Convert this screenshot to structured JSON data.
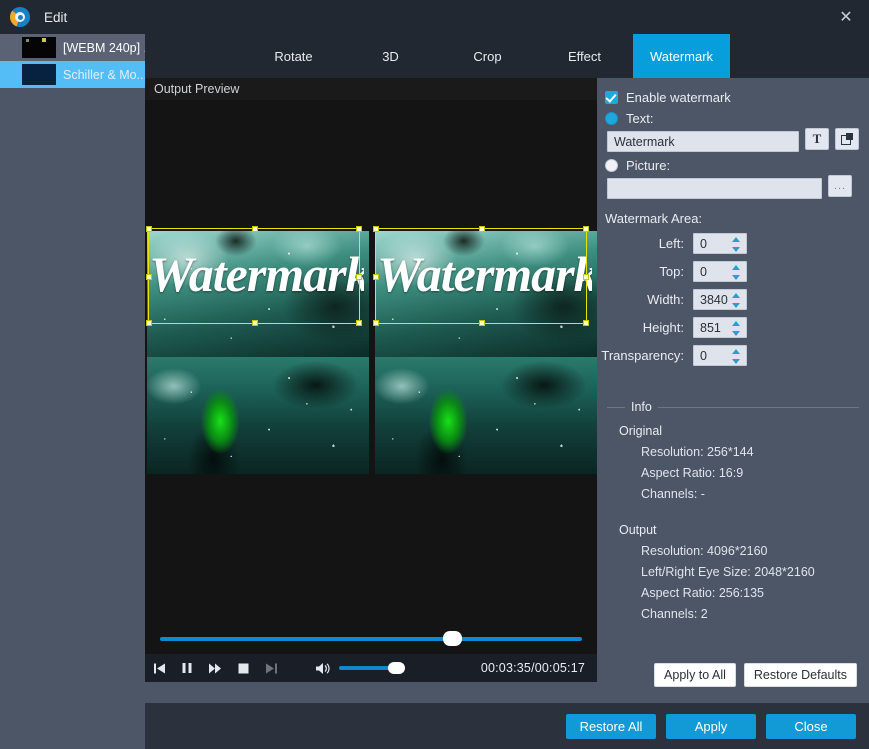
{
  "window": {
    "title": "Edit",
    "app_icon": "app-logo-icon",
    "close_icon": "close-icon"
  },
  "sidebar": {
    "items": [
      {
        "label": "[WEBM 240p] ..",
        "selected": false
      },
      {
        "label": "Schiller & Mo...",
        "selected": true
      }
    ]
  },
  "tabs": [
    {
      "label": "Rotate",
      "active": false
    },
    {
      "label": "3D",
      "active": false
    },
    {
      "label": "Crop",
      "active": false
    },
    {
      "label": "Effect",
      "active": false
    },
    {
      "label": "Watermark",
      "active": true
    }
  ],
  "preview": {
    "label": "Output Preview",
    "watermark_overlay_text": "Watermark",
    "transport": {
      "prev_icon": "skip-previous-icon",
      "pause_icon": "pause-icon",
      "forward_icon": "fast-forward-icon",
      "stop_icon": "stop-icon",
      "next_icon": "skip-next-icon",
      "volume_icon": "volume-icon",
      "time": "00:03:35/00:05:17"
    }
  },
  "settings": {
    "enable_watermark": {
      "label": "Enable watermark",
      "checked": true
    },
    "text_option": {
      "label": "Text:",
      "selected": true
    },
    "text_value": "Watermark",
    "font_button_icon": "font-text-icon",
    "color_button_icon": "layers-color-icon",
    "picture_option": {
      "label": "Picture:",
      "selected": false
    },
    "picture_value": "",
    "browse_button_label": "...",
    "area_label": "Watermark Area:",
    "fields": [
      {
        "label": "Left:",
        "value": "0"
      },
      {
        "label": "Top:",
        "value": "0"
      },
      {
        "label": "Width:",
        "value": "3840"
      },
      {
        "label": "Height:",
        "value": "851"
      },
      {
        "label": "Transparency:",
        "value": "0"
      }
    ],
    "info": {
      "title": "Info",
      "original_head": "Original",
      "original_lines": [
        "Resolution: 256*144",
        "Aspect Ratio: 16:9",
        "Channels: -"
      ],
      "output_head": "Output",
      "output_lines": [
        "Resolution: 4096*2160",
        "Left/Right Eye Size: 2048*2160",
        "Aspect Ratio: 256:135",
        "Channels: 2"
      ]
    },
    "apply_to_all_label": "Apply to All",
    "restore_defaults_label": "Restore Defaults"
  },
  "footer": {
    "restore_all_label": "Restore All",
    "apply_label": "Apply",
    "close_label": "Close"
  },
  "colors": {
    "accent": "#129ad6",
    "panel_bg": "#4d5666",
    "titlebar_bg": "#222831",
    "selection_blue": "#55bdf5",
    "watermark_box": "#e6e600"
  }
}
